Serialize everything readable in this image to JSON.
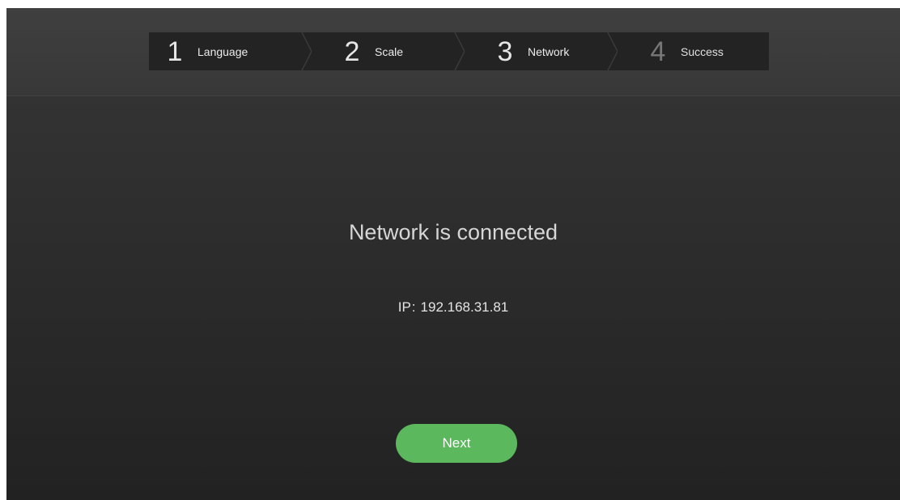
{
  "stepper": {
    "steps": [
      {
        "number": "1",
        "label": "Language",
        "state": "done"
      },
      {
        "number": "2",
        "label": "Scale",
        "state": "done"
      },
      {
        "number": "3",
        "label": "Network",
        "state": "current"
      },
      {
        "number": "4",
        "label": "Success",
        "state": "pending"
      }
    ]
  },
  "status": {
    "title": "Network is connected",
    "ip_label": "IP",
    "ip_separator": ":",
    "ip_value": "192.168.31.81"
  },
  "actions": {
    "next_label": "Next"
  },
  "colors": {
    "accent_green": "#5cb85c",
    "stepper_background": "#232323",
    "screen_background": "#2b2b2b"
  }
}
